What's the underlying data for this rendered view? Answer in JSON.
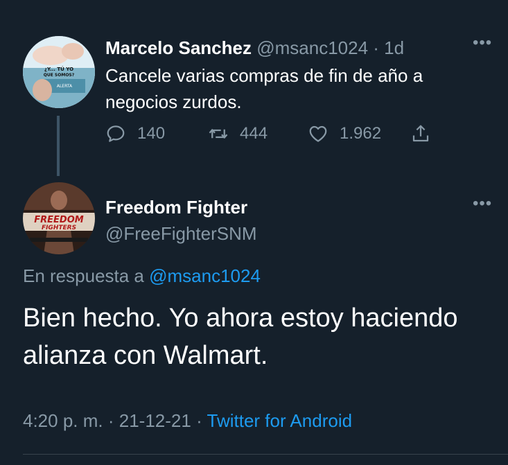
{
  "original_tweet": {
    "name": "Marcelo Sanchez",
    "handle": "@msanc1024",
    "separator": "·",
    "time": "1d",
    "text": "Cancele varias compras de fin de año a negocios zurdos.",
    "avatar_text": [
      "¿Y... TÚ YO",
      "QUE SOMOS?",
      "ALERTA"
    ],
    "actions": {
      "reply_icon": "reply-icon",
      "reply_count": "140",
      "retweet_icon": "retweet-icon",
      "retweet_count": "444",
      "like_icon": "heart-icon",
      "like_count": "1.962",
      "share_icon": "share-icon"
    },
    "more_icon": "more-dots-icon"
  },
  "reply_tweet": {
    "name": "Freedom Fighter",
    "handle": "@FreeFighterSNM",
    "avatar_text": [
      "FREEDOM",
      "FIGHTERS"
    ],
    "reply_prefix": "En respuesta a",
    "reply_to": "@msanc1024",
    "text": "Bien hecho. Yo ahora estoy haciendo alianza con Walmart.",
    "time": "4:20 p. m.",
    "sep1": "·",
    "date": "21-12-21",
    "sep2": "·",
    "source": "Twitter for Android",
    "more_icon": "more-dots-icon"
  },
  "colors": {
    "background": "#15202b",
    "text": "#ffffff",
    "muted": "#8899a6",
    "link": "#1d9bf0",
    "thread_line": "#3d5466"
  }
}
